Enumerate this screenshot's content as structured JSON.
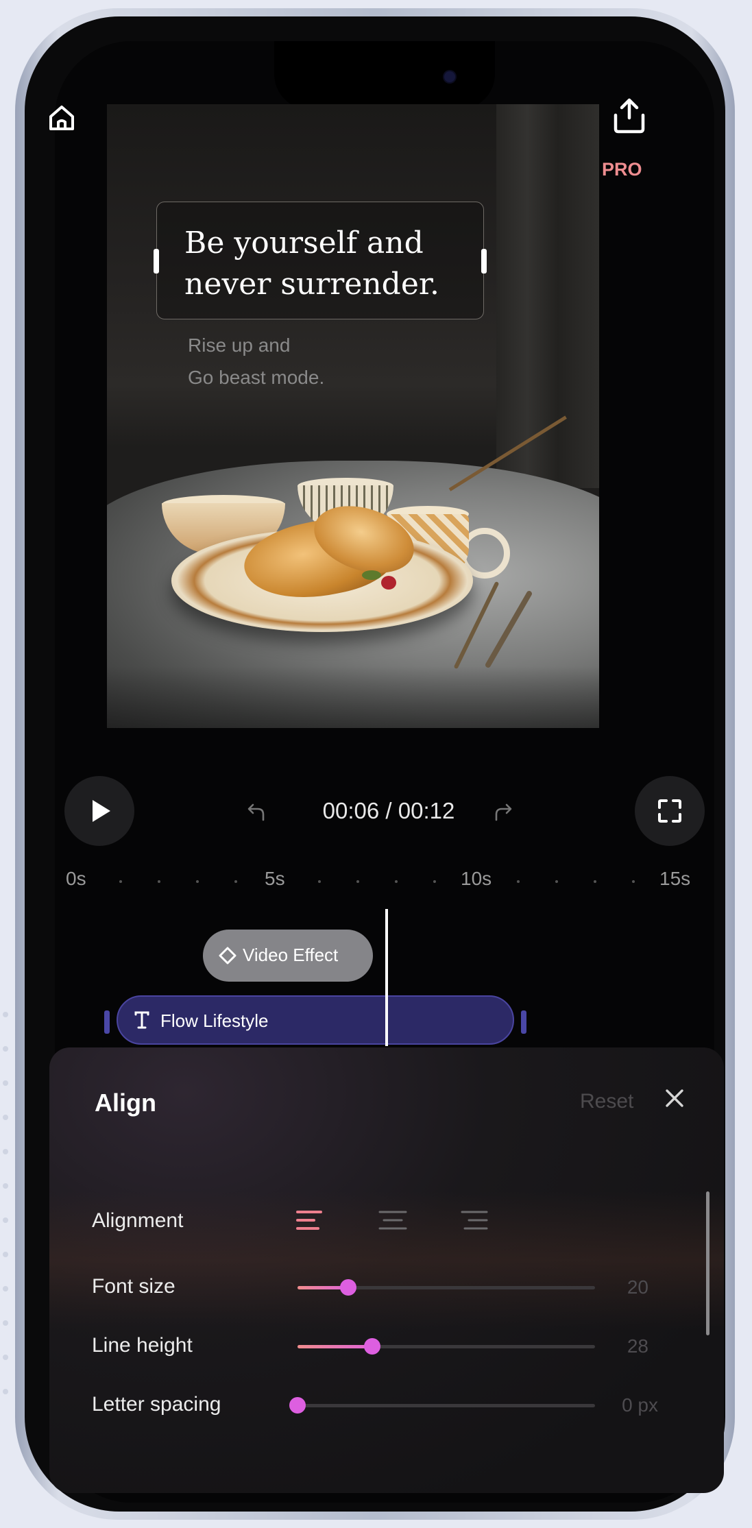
{
  "header": {
    "pro_label": "PRO"
  },
  "preview": {
    "title_text": "Be yourself and\nnever surrender.",
    "subtitle_text": "Rise up and\nGo beast mode."
  },
  "player": {
    "time": "00:06 / 00:12",
    "current": "00:06",
    "total": "00:12"
  },
  "timeline": {
    "ruler_labels": [
      "0s",
      "5s",
      "10s",
      "15s"
    ],
    "effect_chip": "Video Effect",
    "text_track": "Flow Lifestyle"
  },
  "align_panel": {
    "title": "Align",
    "reset_label": "Reset",
    "rows": {
      "alignment": {
        "label": "Alignment",
        "selected": "left"
      },
      "font_size": {
        "label": "Font size",
        "value": "20",
        "fraction": 0.17
      },
      "line_height": {
        "label": "Line height",
        "value": "28",
        "fraction": 0.25
      },
      "letter_spacing": {
        "label": "Letter spacing",
        "value": "0 px",
        "fraction": 0.0
      }
    }
  },
  "colors": {
    "accent": "#dd5fe0",
    "pro": "#ee8d90",
    "track": "#2c2966"
  }
}
